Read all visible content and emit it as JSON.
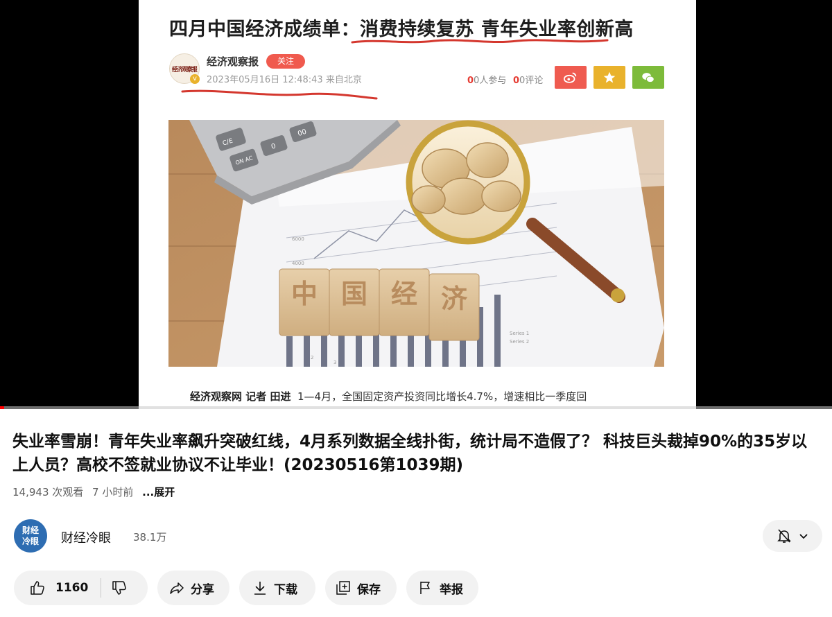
{
  "video_frame": {
    "headline": "四月中国经济成绩单：消费持续复苏 青年失业率创新高",
    "source_logo_text": "经济观察报",
    "source_name": "经济观察报",
    "follow_label": "关注",
    "datetime": "2023年05月16日 12:48:43 来自北京",
    "participants": "0人参与",
    "comments": "0评论",
    "photo_blocks": [
      "中",
      "国",
      "经",
      "济"
    ],
    "photo_legend": [
      "Series 1",
      "Series 2"
    ],
    "calc_keys": [
      "C/E",
      "ON AC",
      "0",
      "00"
    ],
    "chart_ticks": [
      "6000",
      "4000",
      "2000",
      "1",
      "2",
      "3"
    ],
    "caption_bold": "经济观察网 记者 田进",
    "caption_text": "1—4月，全国固定资产投资同比增长4.7%，增速相比一季度回",
    "progress": 0.005
  },
  "video": {
    "title": "失业率雪崩！青年失业率飙升突破红线，4月系列数据全线扑街，统计局不造假了？ 科技巨头裁掉90%的35岁以上人员？高校不签就业协议不让毕业！(20230516第1039期)",
    "views": "14,943 次观看",
    "age": "7 小时前",
    "more": "...展开"
  },
  "channel": {
    "avatar_text": "财经\n冷眼",
    "name": "财经冷眼",
    "subscribers": "38.1万"
  },
  "actions": {
    "like_count": "1160",
    "share": "分享",
    "download": "下载",
    "save": "保存",
    "report": "举报"
  },
  "colors": {
    "accent_red": "#e53b32",
    "follow_red": "#f05a4e",
    "weibo": "#ef5b50",
    "favorite": "#e9b22c",
    "wechat": "#7dbb3a",
    "avatar_blue": "#2e6db2",
    "progress": "#ff0000"
  },
  "icons": [
    "weibo-icon",
    "star-icon",
    "wechat-icon",
    "bell-off-icon",
    "chevron-down-icon",
    "thumbs-up-icon",
    "thumbs-down-icon",
    "share-icon",
    "download-icon",
    "save-playlist-icon",
    "flag-icon"
  ]
}
